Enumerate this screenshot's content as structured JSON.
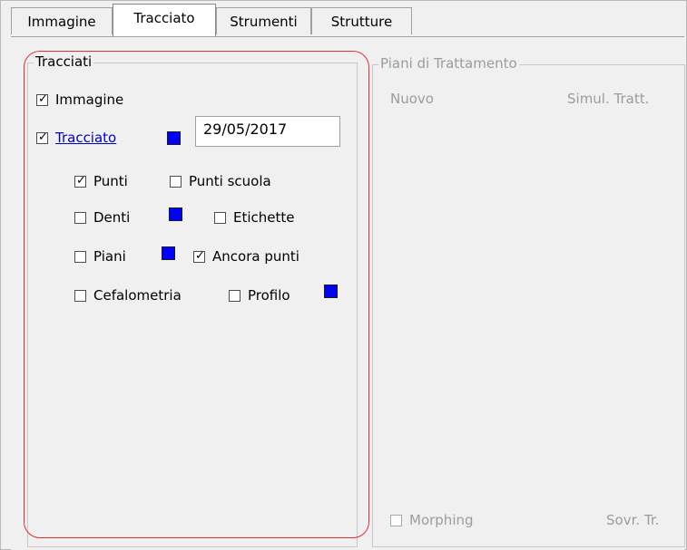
{
  "tabs": [
    {
      "label": "Immagine"
    },
    {
      "label": "Tracciato"
    },
    {
      "label": "Strumenti"
    },
    {
      "label": "Strutture"
    }
  ],
  "tracciati": {
    "title": "Tracciati",
    "immagine_label": "Immagine",
    "immagine_checked": true,
    "tracciato_label": "Tracciato",
    "tracciato_checked": true,
    "tracciato_color": "#0000ff",
    "date": "29/05/2017",
    "punti_label": "Punti",
    "punti_checked": true,
    "punti_scuola_label": "Punti scuola",
    "punti_scuola_checked": false,
    "denti_label": "Denti",
    "denti_checked": false,
    "denti_color": "#0000ff",
    "etichette_label": "Etichette",
    "etichette_checked": false,
    "piani_label": "Piani",
    "piani_checked": false,
    "piani_color": "#0000ff",
    "ancora_punti_label": "Ancora punti",
    "ancora_punti_checked": true,
    "cefalometria_label": "Cefalometria",
    "cefalometria_checked": false,
    "profilo_label": "Profilo",
    "profilo_checked": false,
    "profilo_color": "#0000ff"
  },
  "piani": {
    "title": "Piani di Trattamento",
    "nuovo_label": "Nuovo",
    "simul_label": "Simul. Tratt.",
    "morphing_label": "Morphing",
    "morphing_checked": false,
    "sovr_label": "Sovr. Tr."
  }
}
